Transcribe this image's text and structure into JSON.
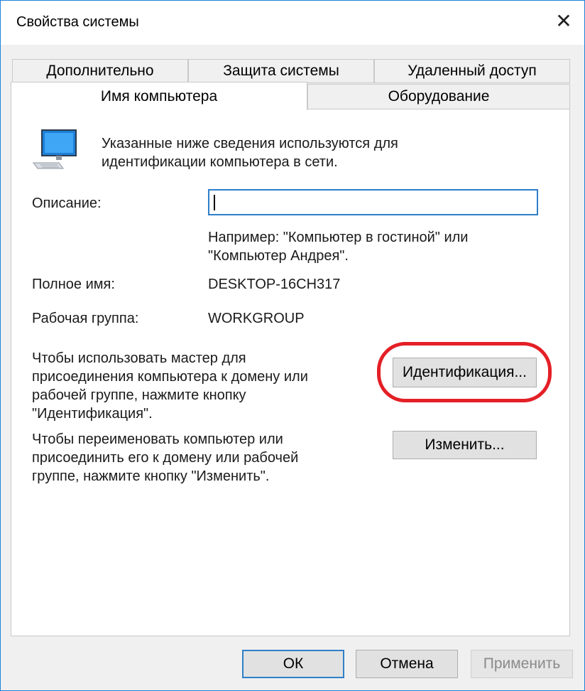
{
  "window": {
    "title": "Свойства системы",
    "close_glyph": "✕"
  },
  "tabs": {
    "row1": [
      "Дополнительно",
      "Защита системы",
      "Удаленный доступ"
    ],
    "row2": [
      "Имя компьютера",
      "Оборудование"
    ],
    "active": "Имя компьютера"
  },
  "panel": {
    "intro_line1": "Указанные ниже сведения используются для",
    "intro_line2": "идентификации компьютера в сети.",
    "description_label": "Описание:",
    "description_value": "",
    "example_line1": "Например: \"Компьютер в гостиной\" или",
    "example_line2": "\"Компьютер Андрея\".",
    "full_name_label": "Полное имя:",
    "full_name_value": "DESKTOP-16CH317",
    "workgroup_label": "Рабочая группа:",
    "workgroup_value": "WORKGROUP",
    "wizard_text": [
      "Чтобы использовать мастер для",
      "присоединения компьютера к домену или",
      "рабочей группе, нажмите кнопку",
      "\"Идентификация\"."
    ],
    "identify_button": "Идентификация...",
    "rename_text": [
      "Чтобы переименовать компьютер или",
      "присоединить его к домену или рабочей",
      "группе, нажмите кнопку \"Изменить\"."
    ],
    "change_button": "Изменить..."
  },
  "footer": {
    "ok": "ОК",
    "cancel": "Отмена",
    "apply": "Применить"
  },
  "colors": {
    "accent": "#2e7fc9",
    "highlight": "#e41f26",
    "window_border": "#1d82d8"
  },
  "icons": {
    "computer": "computer-monitor-icon"
  }
}
